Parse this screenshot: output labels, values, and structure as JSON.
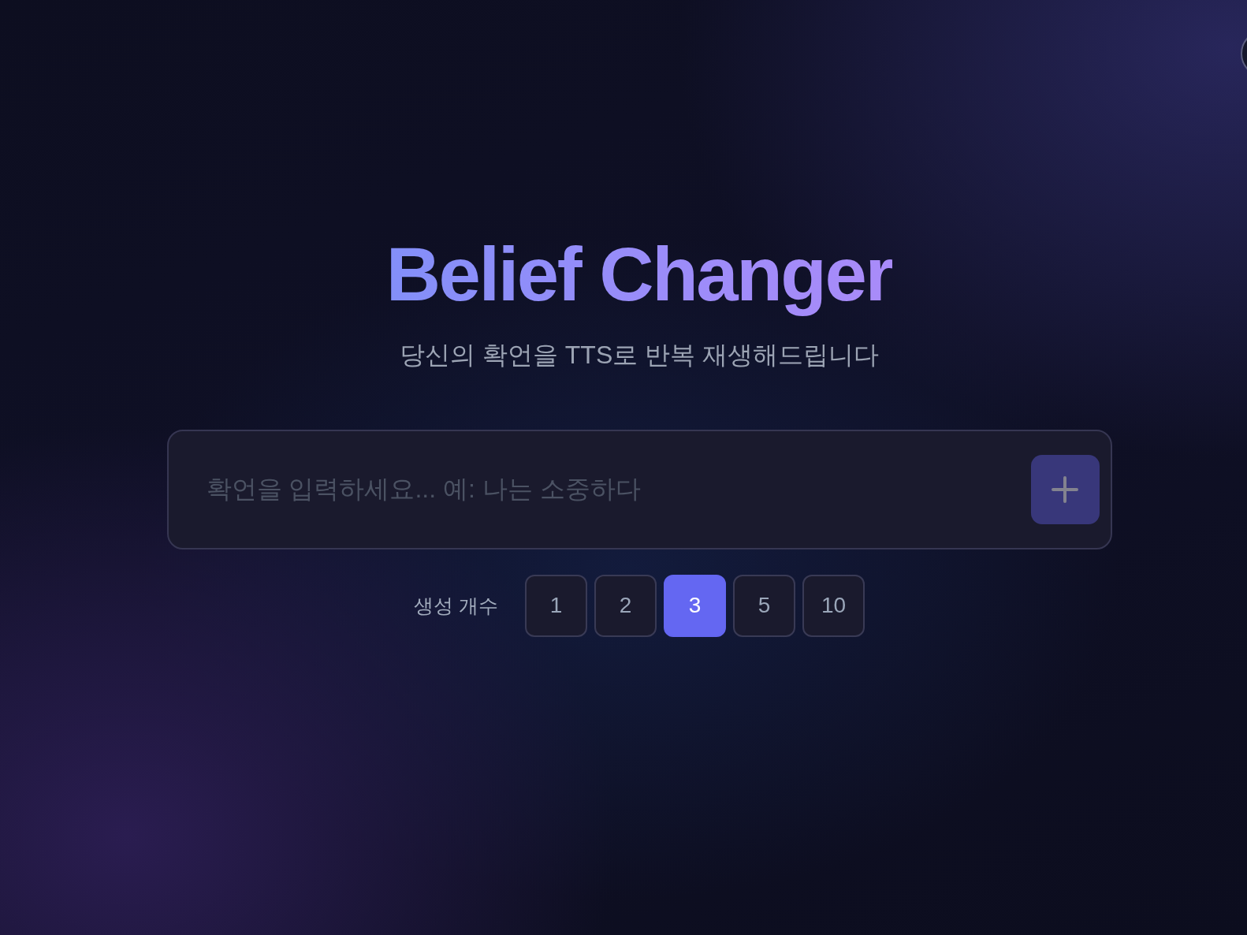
{
  "title": "Belief Changer",
  "subtitle": "당신의 확언을 TTS로 반복 재생해드립니다",
  "affirmation_input": {
    "placeholder": "확언을 입력하세요... 예: 나는 소중하다"
  },
  "add_button": {
    "disabled": true
  },
  "count_selector": {
    "label": "생성 개수",
    "options": [
      {
        "label": "1",
        "selected": false
      },
      {
        "label": "2",
        "selected": false
      },
      {
        "label": "3",
        "selected": true
      },
      {
        "label": "5",
        "selected": false
      },
      {
        "label": "10",
        "selected": false
      }
    ]
  }
}
